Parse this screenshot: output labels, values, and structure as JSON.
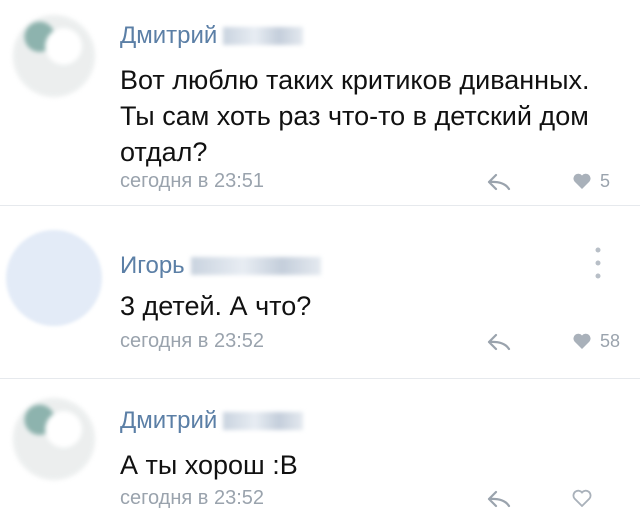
{
  "comments": [
    {
      "author": "Дмитрий",
      "text": "Вот люблю таких критиков диванных. Ты сам хоть раз что-то в детский дом отдал?",
      "time": "сегодня в 23:51",
      "likes": "5"
    },
    {
      "author": "Игорь",
      "text": "3 детей. А что?",
      "time": "сегодня в 23:52",
      "likes": "58"
    },
    {
      "author": "Дмитрий",
      "text": "А ты хорош :В",
      "time": "сегодня в 23:52",
      "likes": ""
    }
  ],
  "icons": {
    "reply": "reply-arrow-icon",
    "like": "heart-icon",
    "more": "vertical-dots-icon"
  },
  "colors": {
    "author": "#5b7fa6",
    "meta": "#9aa3ad",
    "text": "#111111"
  }
}
